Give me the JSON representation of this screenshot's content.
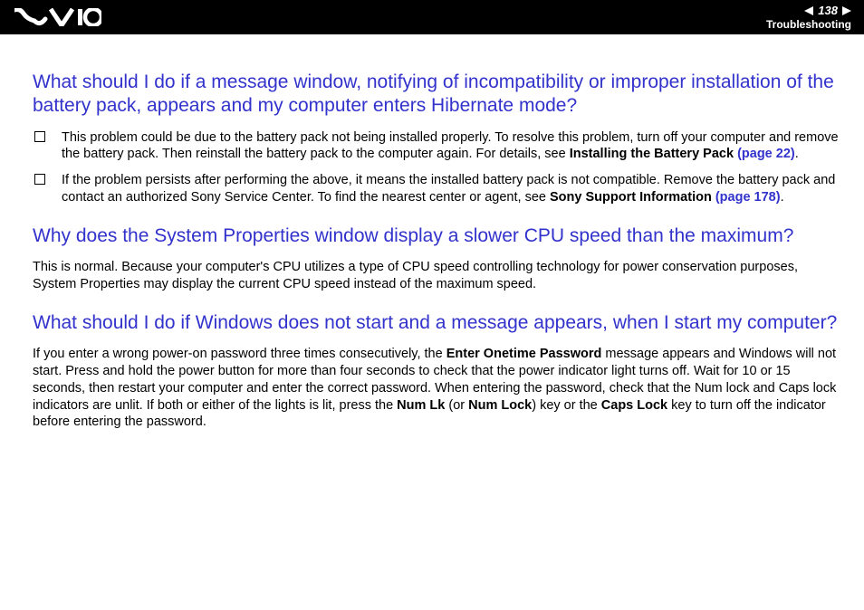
{
  "header": {
    "page_number": "138",
    "section": "Troubleshooting"
  },
  "q1": {
    "title": "What should I do if a message window, notifying of incompatibility or improper installation of the battery pack, appears and my computer enters Hibernate mode?",
    "bullets": [
      {
        "pre": "This problem could be due to the battery pack not being installed properly. To resolve this problem, turn off your computer and remove the battery pack. Then reinstall the battery pack to the computer again. For details, see ",
        "bold": "Installing the Battery Pack ",
        "link": "(page 22)",
        "post": "."
      },
      {
        "pre": "If the problem persists after performing the above, it means the installed battery pack is not compatible. Remove the battery pack and contact an authorized Sony Service Center. To find the nearest center or agent, see ",
        "bold": "Sony Support Information ",
        "link": "(page 178)",
        "post": "."
      }
    ]
  },
  "q2": {
    "title": "Why does the System Properties window display a slower CPU speed than the maximum?",
    "body": "This is normal. Because your computer's CPU utilizes a type of CPU speed controlling technology for power conservation purposes, System Properties may display the current CPU speed instead of the maximum speed."
  },
  "q3": {
    "title": "What should I do if Windows does not start and a message appears, when I start my computer?",
    "body_parts": {
      "p1": "If you enter a wrong power-on password three times consecutively, the ",
      "b1": "Enter Onetime Password",
      "p2": " message appears and Windows will not start. Press and hold the power button for more than four seconds to check that the power indicator light turns off. Wait for 10 or 15 seconds, then restart your computer and enter the correct password. When entering the password, check that the Num lock and Caps lock indicators are unlit. If both or either of the lights is lit, press the ",
      "b2": "Num Lk",
      "p3": " (or ",
      "b3": "Num Lock",
      "p4": ") key or the ",
      "b4": "Caps Lock",
      "p5": " key to turn off the indicator before entering the password."
    }
  }
}
